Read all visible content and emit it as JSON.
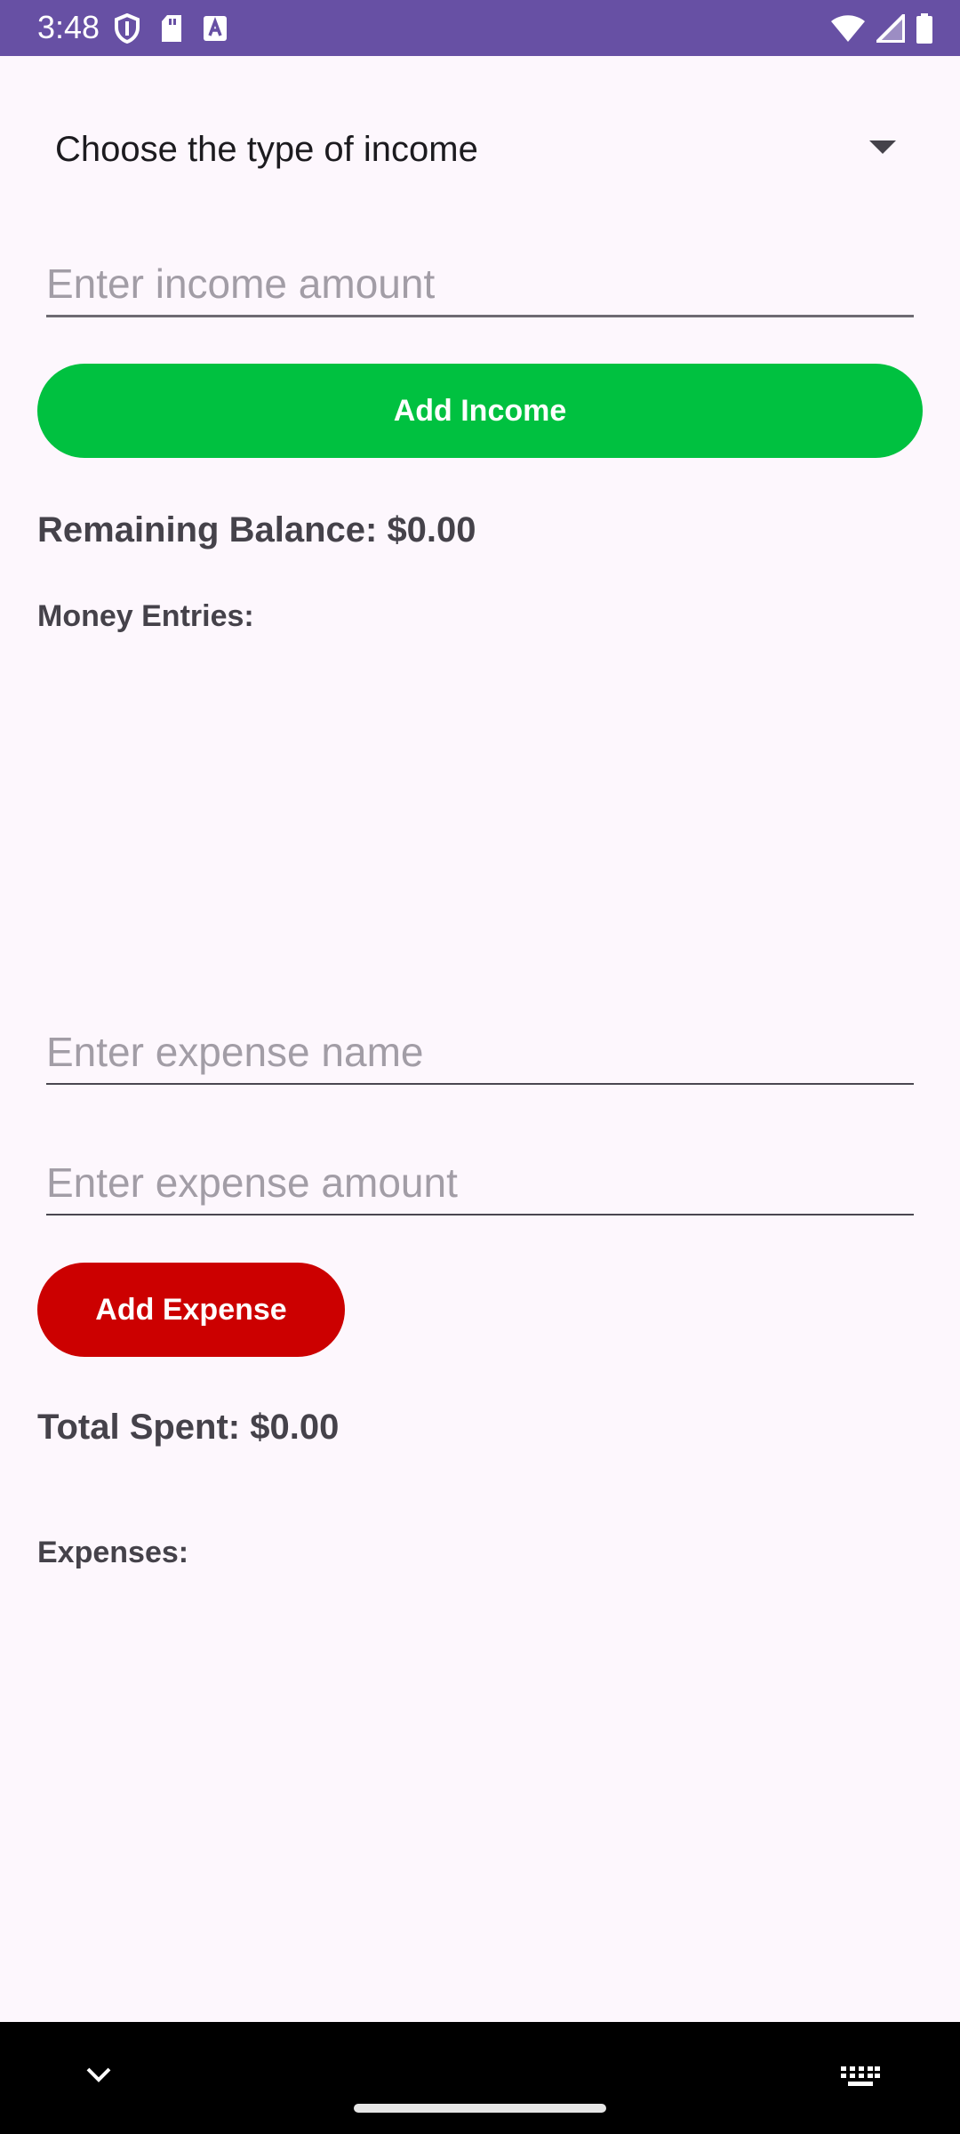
{
  "status_bar": {
    "time": "3:48",
    "left_icons": [
      "shield-icon",
      "sd-card-icon",
      "text-a-icon"
    ],
    "right_icons": [
      "wifi-icon",
      "signal-icon",
      "battery-icon"
    ],
    "background": "#6750a4"
  },
  "income": {
    "spinner_label": "Choose the type of income",
    "amount_placeholder": "Enter income amount",
    "amount_value": "",
    "add_button_label": "Add Income",
    "add_button_color": "#00c140"
  },
  "balance": {
    "remaining_label": "Remaining Balance: $0.00",
    "entries_label": "Money Entries:"
  },
  "expense": {
    "name_placeholder": "Enter expense name",
    "name_value": "",
    "amount_placeholder": "Enter expense amount",
    "amount_value": "",
    "add_button_label": "Add Expense",
    "add_button_color": "#cc0000",
    "total_spent_label": "Total Spent: $0.00",
    "expenses_label": "Expenses:"
  },
  "nav_bar": {
    "icons": [
      "chevron-down-icon",
      "keyboard-icon"
    ]
  }
}
